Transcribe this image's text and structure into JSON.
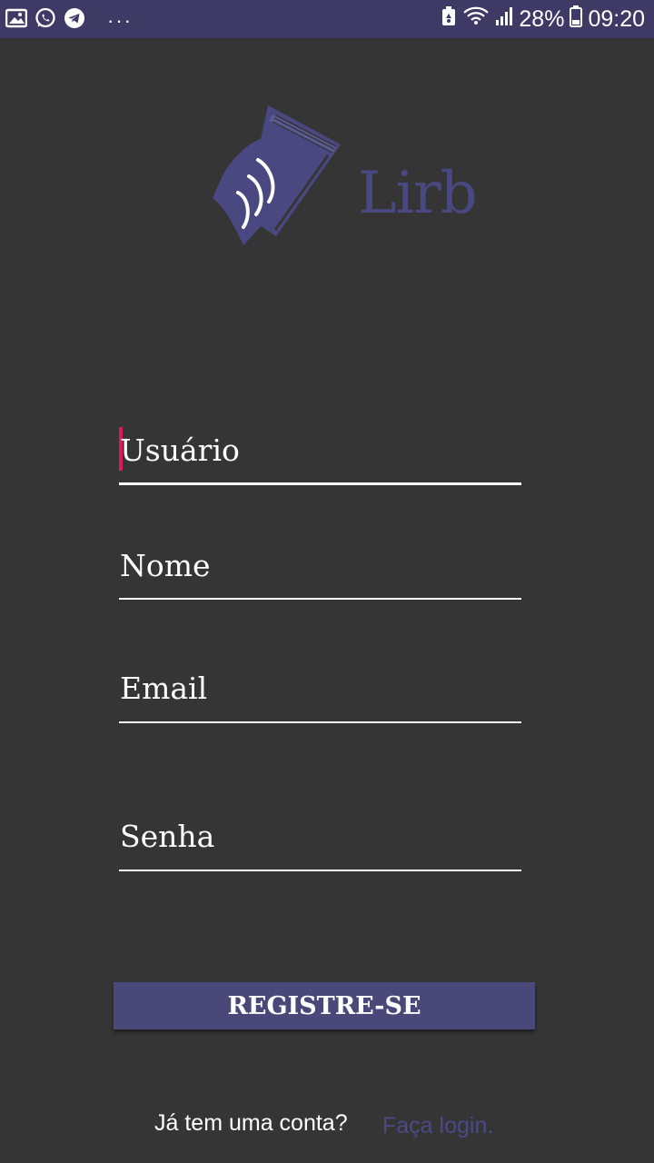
{
  "status_bar": {
    "battery_percent": "28%",
    "time": "09:20",
    "icons": [
      "gallery-icon",
      "whatsapp-icon",
      "telegram-icon",
      "more-notifications-icon",
      "recycle-icon",
      "wifi-icon",
      "signal-icon",
      "battery-icon"
    ],
    "dots": "···"
  },
  "logo": {
    "text": "Lirb",
    "icon": "book-icon",
    "color": "#4a4880"
  },
  "form": {
    "username_label": "Usuário",
    "name_label": "Nome",
    "email_label": "Email",
    "password_label": "Senha"
  },
  "register_button": {
    "label": "REGISTRE-SE",
    "color": "#4a4878"
  },
  "footer": {
    "text": "Já tem uma conta?",
    "link": "Faça login.",
    "link_color": "#4c4a86"
  },
  "colors": {
    "background": "#353535",
    "status_bar": "#3d3b66",
    "cursor": "#d81b60"
  }
}
